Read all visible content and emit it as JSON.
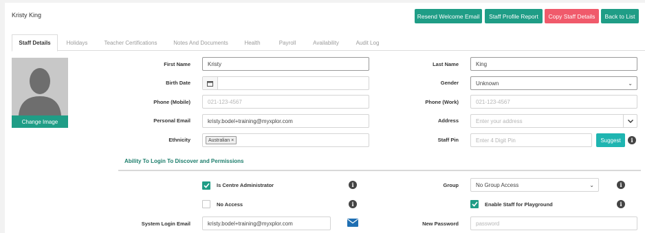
{
  "header": {
    "title": "Kristy King",
    "buttons": {
      "resend_welcome": "Resend Welcome Email",
      "profile_report": "Staff Profile Report",
      "copy_details": "Copy Staff Details",
      "back_to_list": "Back to List"
    }
  },
  "tabs": [
    "Staff Details",
    "Holidays",
    "Teacher Certifications",
    "Notes And Documents",
    "Health",
    "Payroll",
    "Availability",
    "Audit Log"
  ],
  "avatar": {
    "change_label": "Change Image"
  },
  "form": {
    "first_name": {
      "label": "First Name",
      "value": "Kristy"
    },
    "last_name": {
      "label": "Last Name",
      "value": "King"
    },
    "birth_date": {
      "label": "Birth Date",
      "value": ""
    },
    "gender": {
      "label": "Gender",
      "value": "Unknown"
    },
    "phone_mobile": {
      "label": "Phone (Mobile)",
      "placeholder": "021-123-4567"
    },
    "phone_work": {
      "label": "Phone (Work)",
      "placeholder": "021-123-4567"
    },
    "personal_email": {
      "label": "Personal Email",
      "value": "kristy.bodel+training@myxplor.com"
    },
    "address": {
      "label": "Address",
      "placeholder": "Enter your address"
    },
    "ethnicity": {
      "label": "Ethnicity",
      "tag": "Australian"
    },
    "staff_pin": {
      "label": "Staff Pin",
      "placeholder": "Enter 4 Digit Pin",
      "suggest": "Suggest"
    }
  },
  "permissions": {
    "section_title": "Ability To Login To Discover and Permissions",
    "is_centre_admin": {
      "label": "Is Centre Administrator",
      "checked": true
    },
    "no_access": {
      "label": "No Access",
      "checked": false
    },
    "group": {
      "label": "Group",
      "value": "No Group Access"
    },
    "enable_playground": {
      "label": "Enable Staff for Playground",
      "checked": true
    },
    "system_login_email": {
      "label": "System Login Email",
      "value": "kristy.bodel+training@myxplor.com"
    },
    "new_password": {
      "label": "New Password",
      "placeholder": "password"
    }
  },
  "colors": {
    "accent": "#1f9d86",
    "danger": "#f05a6b",
    "suggest": "#1fb5b1"
  }
}
